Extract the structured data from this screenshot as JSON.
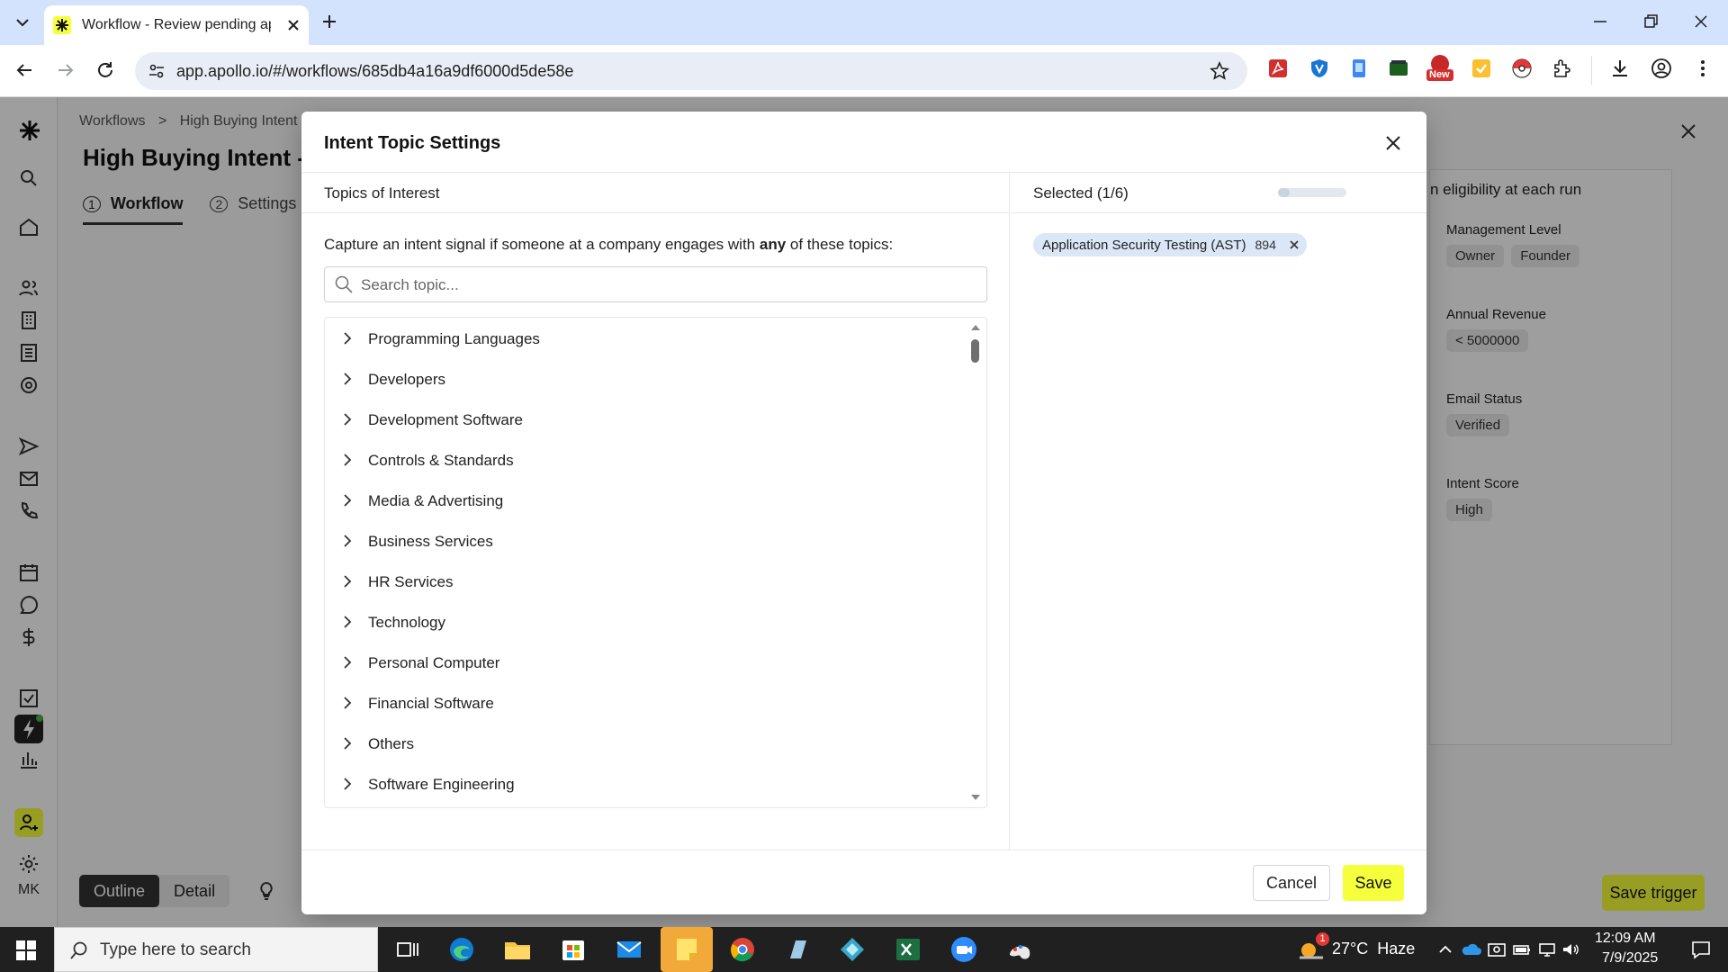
{
  "browser": {
    "tab_title": "Workflow - Review pending app",
    "url": "app.apollo.io/#/workflows/685db4a16a9df6000d5de58e",
    "ext_new_badge": "New",
    "accent": "#d3e3fd"
  },
  "app": {
    "breadcrumb_root": "Workflows",
    "breadcrumb_sep": ">",
    "breadcrumb_current": "High Buying Intent - W",
    "page_title": "High Buying Intent - W",
    "tab_workflow_num": "1",
    "tab_workflow": "Workflow",
    "tab_settings_num": "2",
    "tab_settings": "Settings",
    "outline": "Outline",
    "detail": "Detail",
    "save_trigger": "Save trigger",
    "user_initials": "MK",
    "right_panel": {
      "eligibility": "n eligibility at each run",
      "management_level_label": "Management Level",
      "management_levels": [
        "Owner",
        "Founder"
      ],
      "annual_revenue_label": "Annual Revenue",
      "annual_revenue": "< 5000000",
      "email_status_label": "Email Status",
      "email_status": "Verified",
      "intent_score_label": "Intent Score",
      "intent_score": "High"
    }
  },
  "modal": {
    "title": "Intent Topic Settings",
    "left_header": "Topics of Interest",
    "instruction_pre": "Capture an intent signal if someone at a company engages with ",
    "instruction_bold": "any",
    "instruction_post": " of these topics:",
    "search_placeholder": "Search topic...",
    "topics": [
      "Programming Languages",
      "Developers",
      "Development Software",
      "Controls & Standards",
      "Media & Advertising",
      "Business Services",
      "HR Services",
      "Technology",
      "Personal Computer",
      "Financial Software",
      "Others",
      "Software Engineering"
    ],
    "selected_header": "Selected (1/6)",
    "selected_fraction": 0.1667,
    "selected_items": [
      {
        "label": "Application Security Testing (AST)",
        "count": "894"
      }
    ],
    "cancel_label": "Cancel",
    "save_label": "Save",
    "save_color": "#f5ff3b"
  },
  "taskbar": {
    "search_placeholder": "Type here to search",
    "weather": "27°C  Haze",
    "time": "12:09 AM",
    "date": "7/9/2025",
    "weather_badge": "1"
  }
}
